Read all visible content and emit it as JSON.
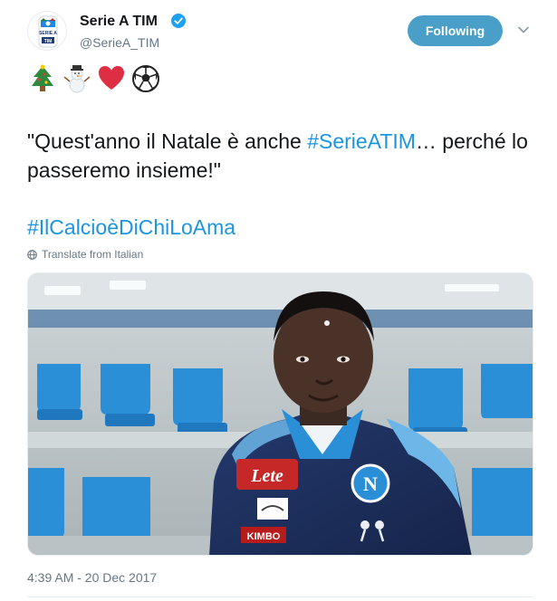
{
  "account": {
    "name": "Serie A TIM",
    "handle": "@SerieA_TIM",
    "logo_text_top": "SERIE A",
    "logo_text_bottom": "TIM"
  },
  "follow_button": {
    "label": "Following"
  },
  "emojis": [
    "christmas-tree",
    "snowman",
    "red-heart",
    "soccer-ball"
  ],
  "tweet": {
    "line1_text": "\"Quest'anno il Natale è anche ",
    "line1_hashtag": "#SerieATIM",
    "line1_suffix": "… perché lo passeremo insieme!\"",
    "hashtag2": "#IlCalcioèDiChiLoAma"
  },
  "translate": {
    "label": "Translate from Italian"
  },
  "media": {
    "sponsor_top": "Lete",
    "sponsor_bottom": "KIMBO",
    "crest_letter": "N"
  },
  "timestamp": "4:39 AM - 20 Dec 2017",
  "colors": {
    "link": "#1b95e0",
    "follow": "#4a9fc9",
    "seat_blue": "#2a8fd6",
    "kit_navy": "#1e2d5c"
  }
}
